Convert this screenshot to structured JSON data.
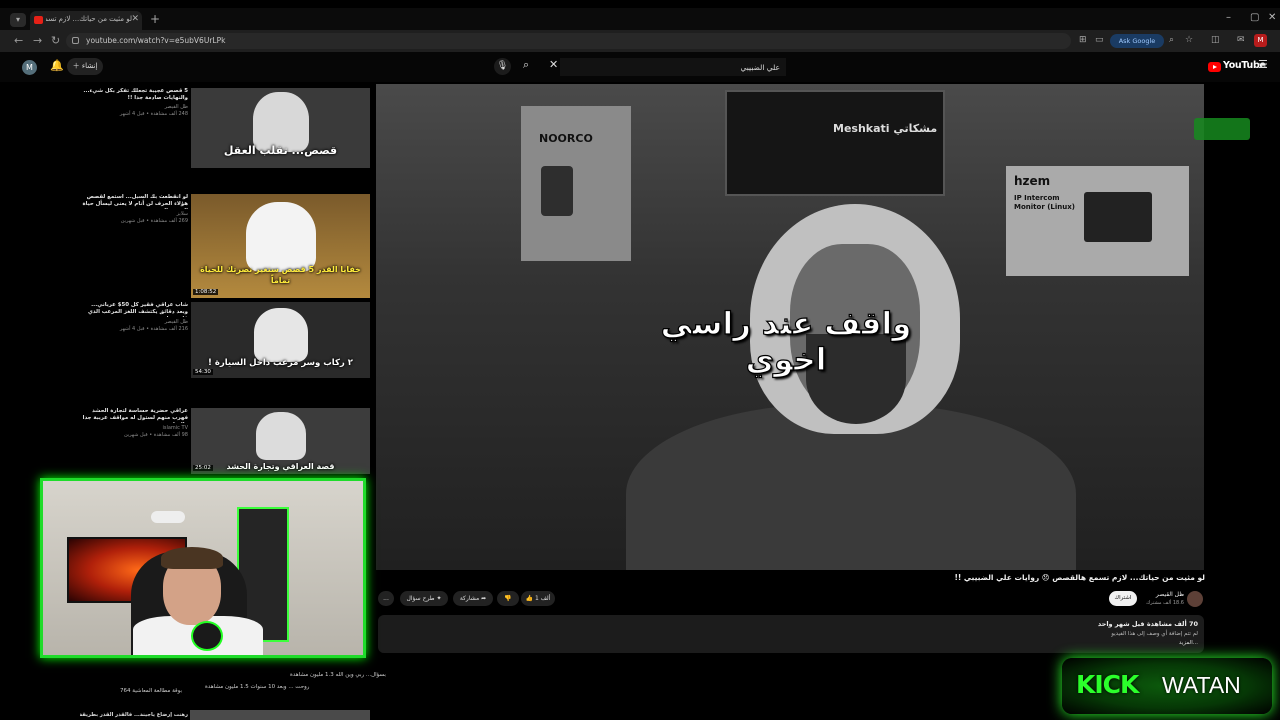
{
  "browser": {
    "tab_title": "لو مثيت من حياتك... لازم تسم...",
    "url": "youtube.com/watch?v=e5ubV6UrLPk",
    "ask_google": "Ask Google"
  },
  "youtube": {
    "account_initial": "M",
    "create_label": "إنشاء",
    "search_value": "علي الضبيبي",
    "logo": "YouTube"
  },
  "recommendations": [
    {
      "title": "5 قصص عجيبة تجعلك تفكر بكل شيء... والنهايات صادمة جدا !!",
      "channel": "ظل القيصر",
      "meta": "248 ألف مشاهدة • قبل 4 أشهر",
      "duration": "",
      "thumb_text": "قصص... تقلب العقل"
    },
    {
      "title": "لو انقطعت بك السبل... استمع لقصص هؤلاء الحرف لن أنام لا يعنى ليسأل حياة السجن الدهور",
      "channel": "سلايز",
      "meta": "269 ألف مشاهدة • قبل شهرين",
      "duration": "1:08:52",
      "thumb_text": "خفايا القدر 5 قصص ستغير نصرتك للحياة تماماً"
    },
    {
      "title": "شاب عراقي فقير كل 50$ عرباني... وبعد دقائق يكتشف اللغز المرعب الذي قلب حياته",
      "channel": "ظل القيصر",
      "meta": "216 ألف مشاهدة • قبل 4 أشهر",
      "duration": "54:30",
      "thumb_text": "٢ ركاب وسر مرعب داخل السيارة !"
    },
    {
      "title": "عراقي حضرية حساسة لتجارة الحشد فهرب منهم لستول له مواقف عرببة جدا والنهاية صعبة",
      "channel": "islamic TV",
      "meta": "98 ألف مشاهدة • قبل شهرين",
      "duration": "25:02",
      "thumb_text": "قصة العراقي وتجارة الحشد"
    }
  ],
  "player": {
    "caption": "واقف عند راسي اخوي",
    "sign_noorco": "NOORCO",
    "sign_meshkati": "Meshkati مشكاتي",
    "sign_hzem": "hzem",
    "sign_ip": "IP Intercom Monitor (Linux)"
  },
  "video": {
    "title": "لو مثيت من حياتك... لازم تسمع هالقصص 😞 روايات علي الضبيبي !!",
    "channel_name": "ظل القيصر",
    "subscribers": "18.6 ألف مشترك",
    "subscribe": "اشتراك",
    "likes": "1 ألف",
    "share": "مشاركة",
    "ask": "طرح سؤال",
    "more": "...",
    "desc_stats": "70 ألف مشاهدة قبل شهر واحد",
    "desc_line": "لم تتم إضافة أي وصف إلى هذا الفيديو",
    "desc_more": "...المزيد"
  },
  "cam_labels": [
    {
      "title": "بسؤال... ربي وين الله",
      "meta": "1.3 مليون مشاهدة"
    },
    {
      "title": "روحت ... وبعد 10 سنوات",
      "meta": "1.5 مليون مشاهدة"
    },
    {
      "title": "بوقة مطالعة المعاشية",
      "meta": "764"
    }
  ],
  "bottom_item": {
    "title": "رهنت إرضاع ياجينة... فالقدر القدر بطريقة مرعبة"
  },
  "overlay": {
    "kick": "KICK",
    "watan": "WATAN"
  },
  "colors": {
    "accent_green": "#1fdc2a",
    "yt_red": "#ff0000"
  }
}
